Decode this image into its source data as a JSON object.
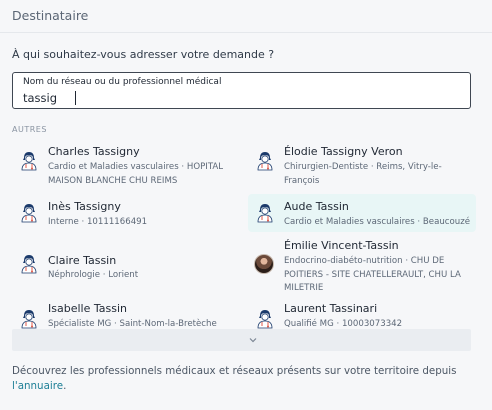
{
  "header": {
    "title": "Destinataire"
  },
  "question": "À qui souhaitez-vous adresser votre demande ?",
  "search": {
    "label": "Nom du réseau ou du professionnel médical",
    "value": "tassig"
  },
  "section_label": "AUTRES",
  "results": [
    {
      "name": "Charles Tassigny",
      "details": "Cardio et Maladies vasculaires · HOPITAL MAISON BLANCHE CHU REIMS",
      "avatar": "doctor-icon",
      "highlighted": false
    },
    {
      "name": "Élodie Tassigny Veron",
      "details": "Chirurgien-Dentiste · Reims, Vitry-le-François",
      "avatar": "doctor-icon",
      "highlighted": false
    },
    {
      "name": "Inès Tassigny",
      "details": "Interne · 10111166491",
      "avatar": "doctor-icon",
      "highlighted": false
    },
    {
      "name": "Aude Tassin",
      "details": "Cardio et Maladies vasculaires · Beaucouzé",
      "avatar": "doctor-icon",
      "highlighted": true
    },
    {
      "name": "Claire Tassin",
      "details": "Néphrologie · Lorient",
      "avatar": "doctor-icon",
      "highlighted": false
    },
    {
      "name": "Émilie Vincent-Tassin",
      "details": "Endocrino-diabéto-nutrition · CHU DE POITIERS - SITE CHATELLERAULT, CHU LA MILETRIE",
      "avatar": "photo",
      "highlighted": false
    },
    {
      "name": "Isabelle Tassin",
      "details": "Spécialiste MG · Saint-Nom-la-Bretèche",
      "avatar": "doctor-icon",
      "highlighted": false
    },
    {
      "name": "Laurent Tassinari",
      "details": "Qualifié MG · 10003073342",
      "avatar": "doctor-icon",
      "highlighted": false
    }
  ],
  "footer": {
    "text": "Découvrez les professionnels médicaux et réseaux présents sur votre territoire depuis ",
    "link": "l'annuaire",
    "end": "."
  },
  "colors": {
    "accent": "#1e7f96",
    "highlight": "#e8f6f6",
    "doctor_icon": "#1b3a6b"
  }
}
